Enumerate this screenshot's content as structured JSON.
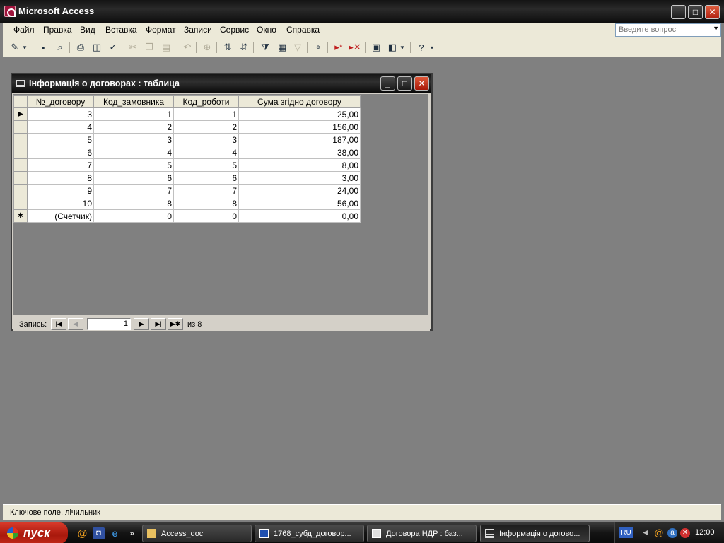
{
  "app": {
    "title": "Microsoft Access"
  },
  "menu": {
    "items": [
      "Файл",
      "Правка",
      "Вид",
      "Вставка",
      "Формат",
      "Записи",
      "Сервис",
      "Окно",
      "Справка"
    ],
    "help_placeholder": "Введите вопрос"
  },
  "table_window": {
    "title": "Інформація о договорах : таблица",
    "columns": [
      "№_договору",
      "Код_замовника",
      "Код_роботи",
      "Сума згідно договору"
    ],
    "rows": [
      [
        "3",
        "1",
        "1",
        "25,00"
      ],
      [
        "4",
        "2",
        "2",
        "156,00"
      ],
      [
        "5",
        "3",
        "3",
        "187,00"
      ],
      [
        "6",
        "4",
        "4",
        "38,00"
      ],
      [
        "7",
        "5",
        "5",
        "8,00"
      ],
      [
        "8",
        "6",
        "6",
        "3,00"
      ],
      [
        "9",
        "7",
        "7",
        "24,00"
      ],
      [
        "10",
        "8",
        "8",
        "56,00"
      ]
    ],
    "new_row": [
      "(Счетчик)",
      "0",
      "0",
      "0,00"
    ],
    "nav": {
      "label": "Запись:",
      "current": "1",
      "of": "из  8"
    }
  },
  "statusbar": {
    "text": "Ключове поле, лічильник"
  },
  "taskbar": {
    "start": "пуск",
    "tasks": [
      "Access_doc",
      "1768_субд_договор...",
      "Договора НДР : баз...",
      "Інформація о догово..."
    ],
    "lang": "RU",
    "clock": "12:00"
  },
  "colors": {
    "workspace": "#808080",
    "titlebar": "#1a1a1a",
    "start": "#c02818"
  }
}
